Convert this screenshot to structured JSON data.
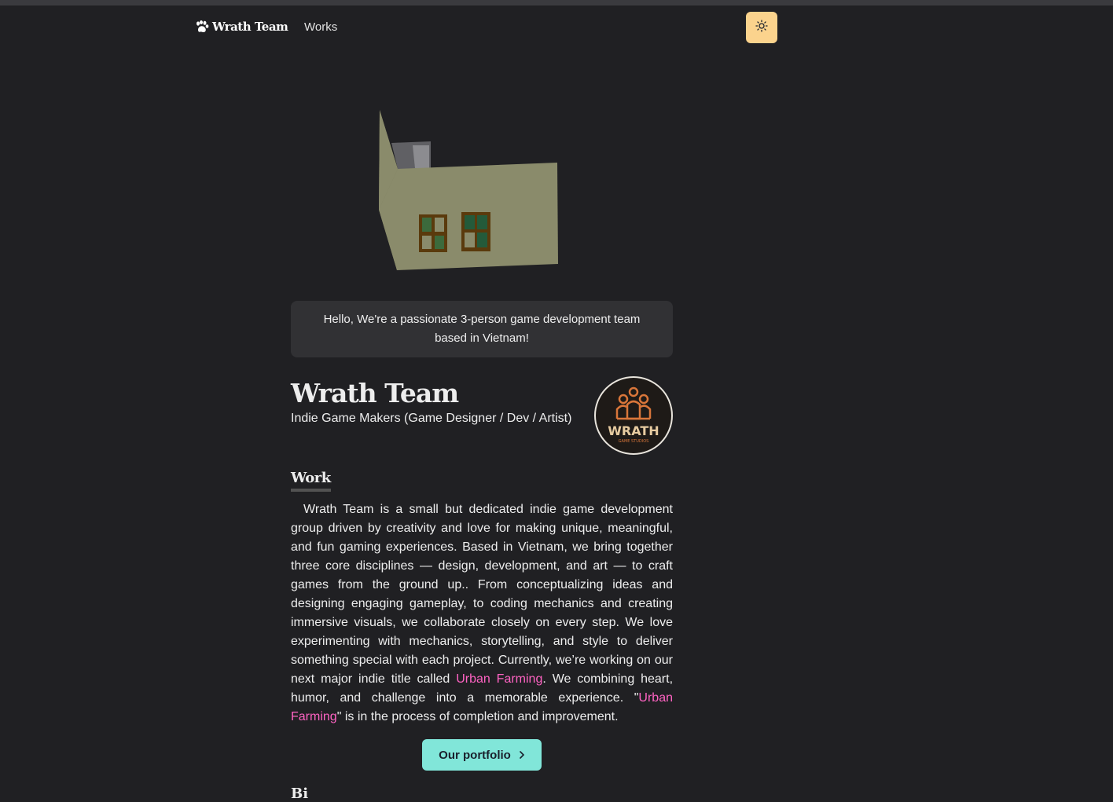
{
  "navbar": {
    "brand": "Wrath Team",
    "brand_icon": "paw-icon",
    "links": [
      {
        "label": "Works"
      }
    ],
    "theme_toggle_icon": "sun-icon",
    "theme_toggle_color": "#fbd38d"
  },
  "hero": {
    "model_description": "3d-house-model",
    "greeting": "Hello, We're a passionate 3-person game development team based in Vietnam!"
  },
  "profile": {
    "title": "Wrath Team",
    "subtitle": "Indie Game Makers (Game Designer / Dev / Artist)",
    "avatar_logo_text": "WRATH",
    "avatar_logo_subtext": "GAME STUDIOS"
  },
  "work_section": {
    "heading": "Work",
    "text_part1": "Wrath Team is a small but dedicated indie game development group driven by creativity and love for making unique, meaningful, and fun gaming experiences. Based in Vietnam, we bring together three core disciplines — design, development, and art — to craft games from the ground up.. From conceptualizing ideas and designing engaging gameplay, to coding mechanics and creating immersive visuals, we collaborate closely on every step. We love experimenting with mechanics, storytelling, and style to deliver something special with each project. Currently, we’re working on our next major indie title called ",
    "link1": "Urban Farming",
    "text_part2": ". We combining heart, humor, and challenge into a memorable experience. \"",
    "link2": "Urban Farming",
    "text_part3": "\" is in the process of completion and improvement.",
    "link_color": "#ff63c3",
    "button_label": "Our portfolio",
    "button_icon": "chevron-right-icon",
    "button_color": "#81e6d9"
  },
  "next_section": {
    "heading_partial": "Bi"
  }
}
